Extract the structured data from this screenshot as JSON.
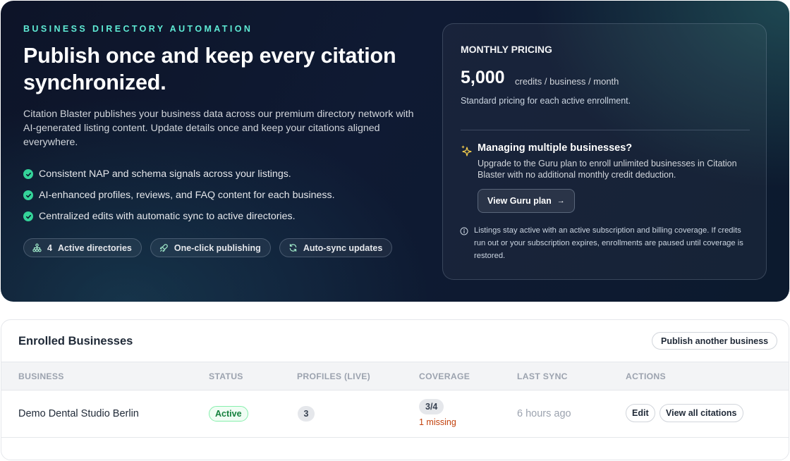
{
  "hero": {
    "eyebrow": "BUSINESS DIRECTORY AUTOMATION",
    "headline": "Publish once and keep every citation synchronized.",
    "lede": "Citation Blaster publishes your business data across our premium directory network with AI-generated listing content. Update details once and keep your citations aligned everywhere.",
    "bullets": [
      "Consistent NAP and schema signals across your listings.",
      "AI-enhanced profiles, reviews, and FAQ content for each business.",
      "Centralized edits with automatic sync to active directories."
    ],
    "pills": {
      "directories": {
        "icon": "network-icon",
        "count": "4",
        "label": "Active directories"
      },
      "publishing": {
        "icon": "rocket-icon",
        "label": "One-click publishing"
      },
      "sync": {
        "icon": "refresh-icon",
        "label": "Auto-sync updates"
      }
    }
  },
  "pricing": {
    "title": "MONTHLY PRICING",
    "amount": "5,000",
    "unit": "credits / business / month",
    "note": "Standard pricing for each active enrollment.",
    "guru_heading": "Managing multiple businesses?",
    "guru_body": "Upgrade to the Guru plan to enroll unlimited businesses in Citation Blaster with no additional monthly credit deduction.",
    "guru_button": "View Guru plan",
    "guru_button_arrow": "→",
    "footnote": "Listings stay active with an active subscription and billing coverage. If credits run out or your subscription expires, enrollments are paused until coverage is restored."
  },
  "enrolled": {
    "title": "Enrolled Businesses",
    "publish_button": "Publish another business",
    "columns": {
      "business": "BUSINESS",
      "status": "STATUS",
      "profiles": "PROFILES (LIVE)",
      "coverage": "COVERAGE",
      "last_sync": "LAST SYNC",
      "actions": "ACTIONS"
    },
    "rows": [
      {
        "business": "Demo Dental Studio Berlin",
        "status": "Active",
        "profiles": "3",
        "coverage": "3/4",
        "coverage_note": "1 missing",
        "last_sync": "6 hours ago",
        "edit": "Edit",
        "view": "View all citations"
      }
    ]
  },
  "colors": {
    "accent_teal": "#5eead4",
    "check_green": "#34d399",
    "status_active": "#15803d",
    "missing_orange": "#c2410c",
    "hero_bg": "#0f1a33"
  }
}
